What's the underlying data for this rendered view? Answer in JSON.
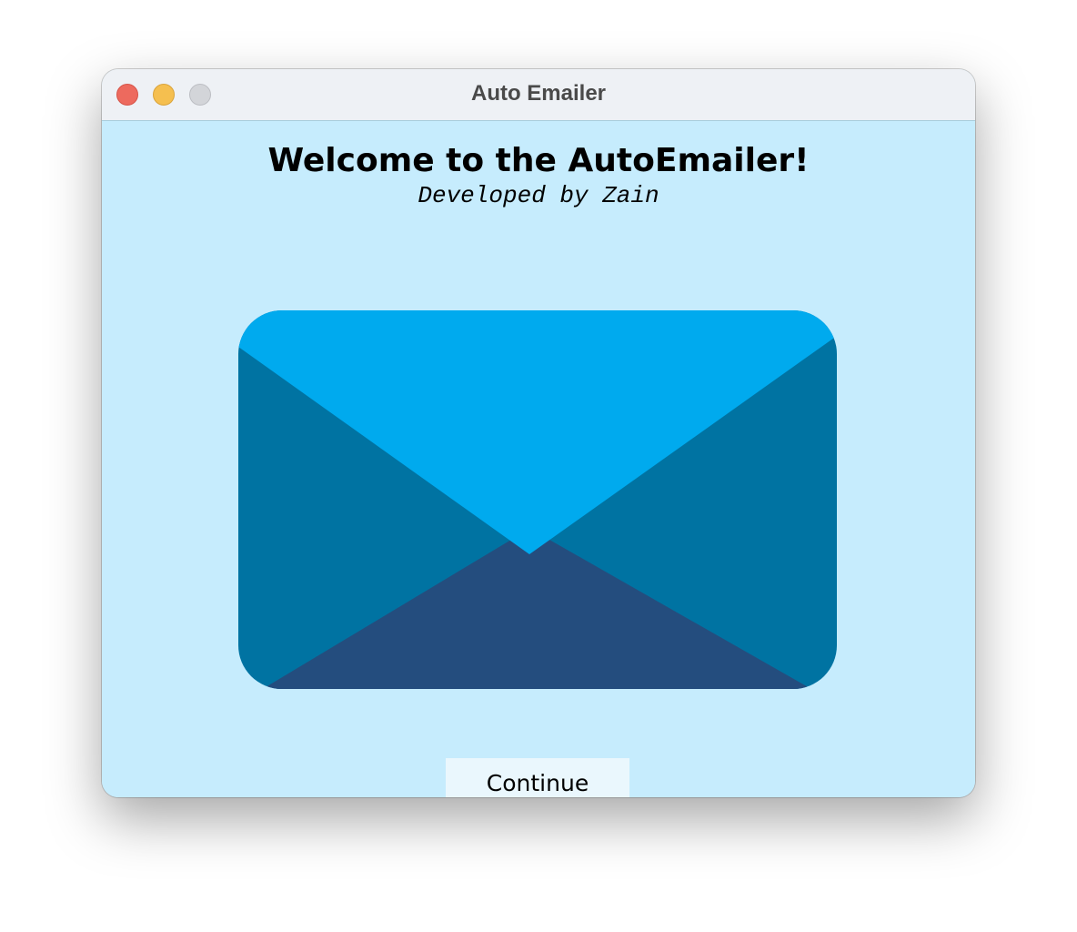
{
  "window": {
    "title": "Auto Emailer"
  },
  "main": {
    "heading": "Welcome to the AutoEmailer!",
    "subheading": "Developed by Zain",
    "illustration": {
      "icon": "envelope-icon",
      "colors": {
        "top_flap": "#00aaee",
        "side_flaps": "#0073a2",
        "bottom_flap": "#244d7e"
      }
    },
    "continue_label": "Continue"
  },
  "colors": {
    "background": "#c6ecfd",
    "titlebar": "#eef1f5",
    "button": "#eaf7fd"
  }
}
